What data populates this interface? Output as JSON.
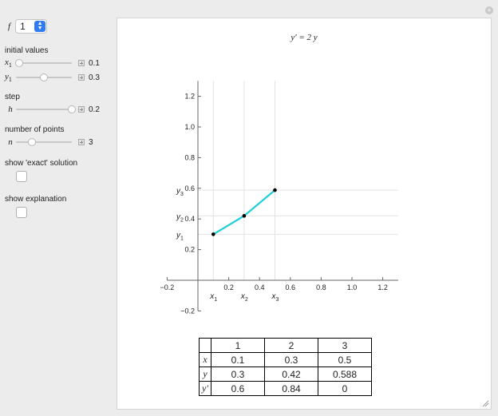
{
  "controls": {
    "f_label": "f",
    "f_value": "1",
    "initial_values_label": "initial values",
    "x1": {
      "name": "x",
      "sub": "1",
      "value": "0.1",
      "level": 0.05
    },
    "y1": {
      "name": "y",
      "sub": "1",
      "value": "0.3",
      "level": 0.5
    },
    "step_label": "step",
    "h": {
      "name": "h",
      "value": "0.2",
      "level": 1.0
    },
    "points_label": "number of points",
    "n": {
      "name": "n",
      "value": "3",
      "level": 0.28
    },
    "exact_label": "show 'exact' solution",
    "explanation_label": "show explanation"
  },
  "plot": {
    "title_main": "y′ = 2 y",
    "x_ticks": [
      "−0.2",
      "0.2",
      "0.4",
      "0.6",
      "0.8",
      "1.0",
      "1.2"
    ],
    "y_ticks": [
      "1.2",
      "1.0",
      "0.8",
      "0.6",
      "0.4",
      "0.2",
      "−0.2"
    ],
    "x_markers": [
      "x1",
      "x2",
      "x3"
    ],
    "y_markers": [
      "y3",
      "y2",
      "y1"
    ],
    "line_color": "#1fcfd6"
  },
  "chart_data": {
    "type": "line",
    "x": [
      0.1,
      0.3,
      0.5
    ],
    "y": [
      0.3,
      0.42,
      0.588
    ],
    "xlim": [
      -0.2,
      1.3
    ],
    "ylim": [
      -0.2,
      1.3
    ]
  },
  "table": {
    "headers": [
      "",
      "1",
      "2",
      "3"
    ],
    "rows": [
      {
        "label": "x",
        "values": [
          "0.1",
          "0.3",
          "0.5"
        ]
      },
      {
        "label": "y",
        "values": [
          "0.3",
          "0.42",
          "0.588"
        ]
      },
      {
        "label": "y′",
        "values": [
          "0.6",
          "0.84",
          "0"
        ]
      }
    ]
  }
}
